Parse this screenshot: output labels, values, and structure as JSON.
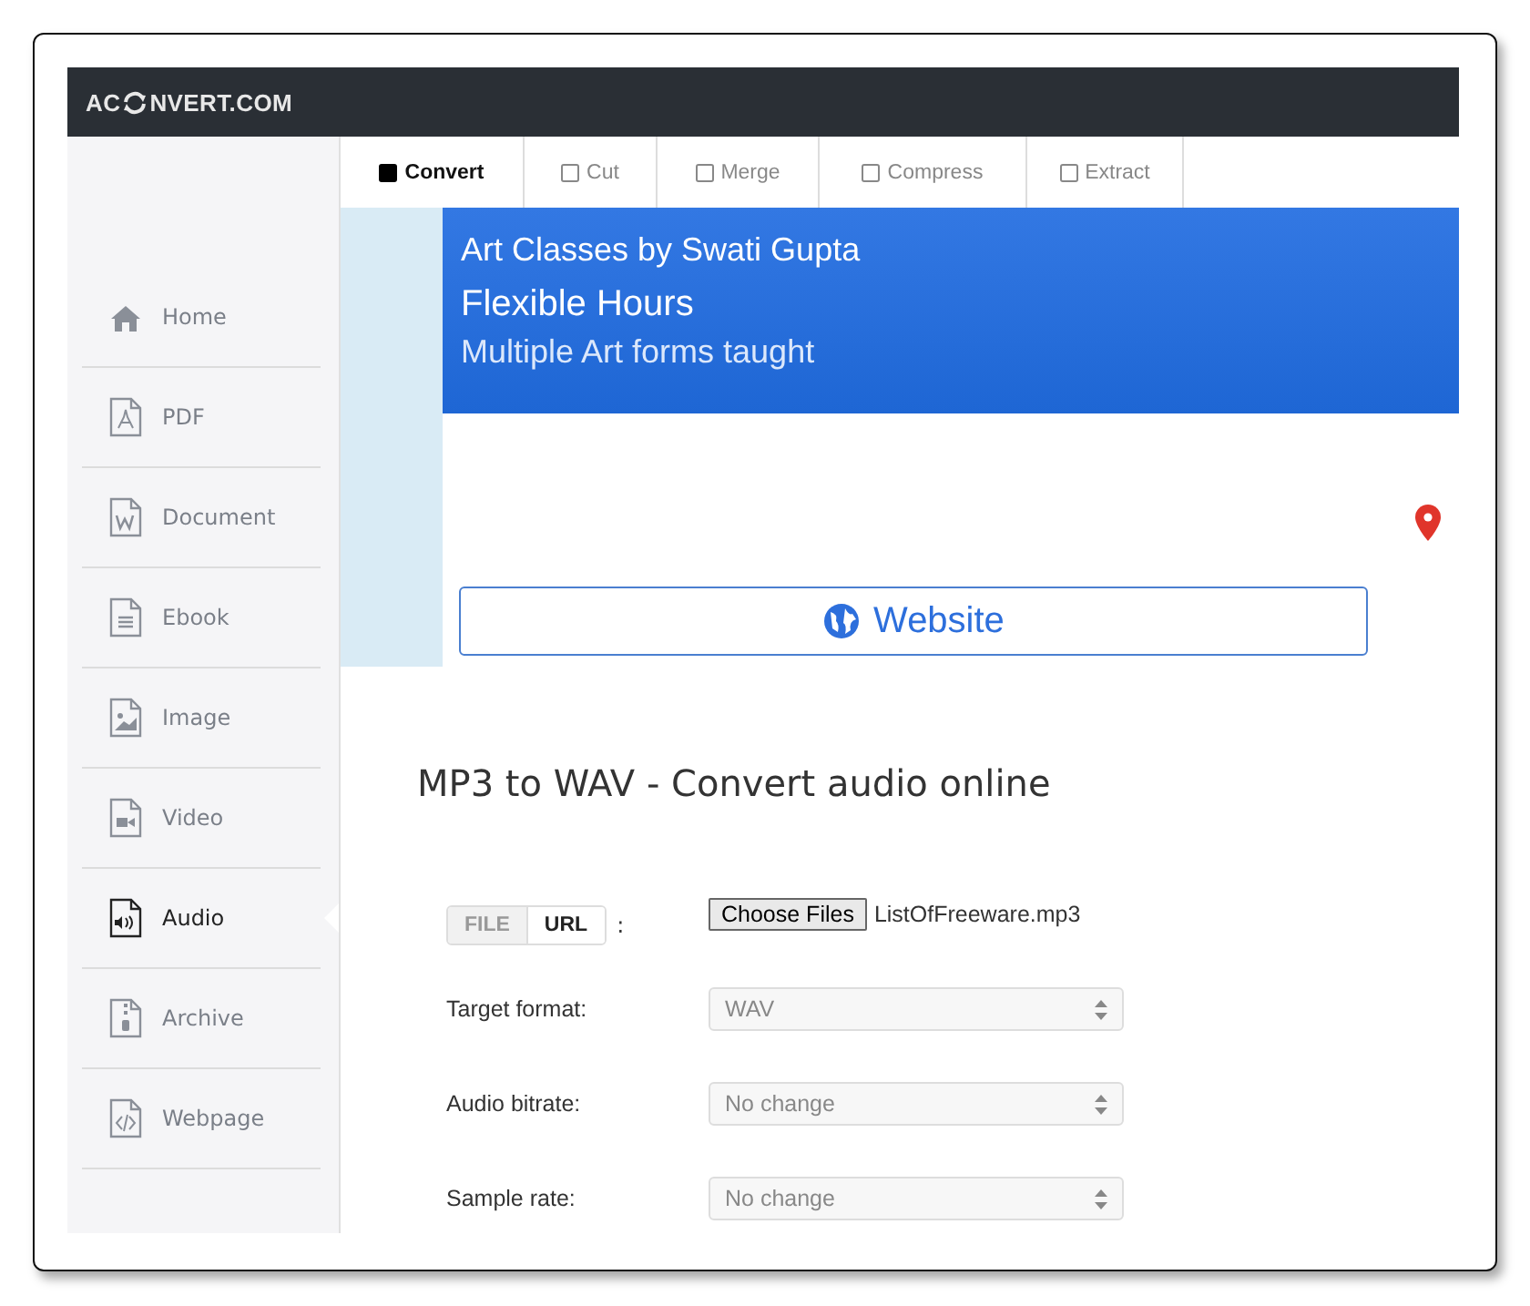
{
  "logo": {
    "before": "AC",
    "after": "NVERT.COM"
  },
  "tabs": [
    {
      "label": "Convert",
      "selected": true
    },
    {
      "label": "Cut",
      "selected": false
    },
    {
      "label": "Merge",
      "selected": false
    },
    {
      "label": "Compress",
      "selected": false
    },
    {
      "label": "Extract",
      "selected": false
    }
  ],
  "sidebar": {
    "items": [
      {
        "label": "Home",
        "selected": false
      },
      {
        "label": "PDF",
        "selected": false
      },
      {
        "label": "Document",
        "selected": false
      },
      {
        "label": "Ebook",
        "selected": false
      },
      {
        "label": "Image",
        "selected": false
      },
      {
        "label": "Video",
        "selected": false
      },
      {
        "label": "Audio",
        "selected": true
      },
      {
        "label": "Archive",
        "selected": false
      },
      {
        "label": "Webpage",
        "selected": false
      }
    ]
  },
  "ad": {
    "title": "Art Classes by Swati Gupta",
    "headline": "Flexible Hours",
    "subline": "Multiple Art forms taught",
    "button": "Website"
  },
  "heading": "MP3 to WAV - Convert audio online",
  "source": {
    "modes": [
      {
        "label": "FILE",
        "selected": true
      },
      {
        "label": "URL",
        "selected": false
      }
    ],
    "colon": ":",
    "button": "Choose Files",
    "file": "ListOfFreeware.mp3"
  },
  "fields": [
    {
      "label": "Target format:",
      "value": "WAV"
    },
    {
      "label": "Audio bitrate:",
      "value": "No change"
    },
    {
      "label": "Sample rate:",
      "value": "No change"
    }
  ]
}
